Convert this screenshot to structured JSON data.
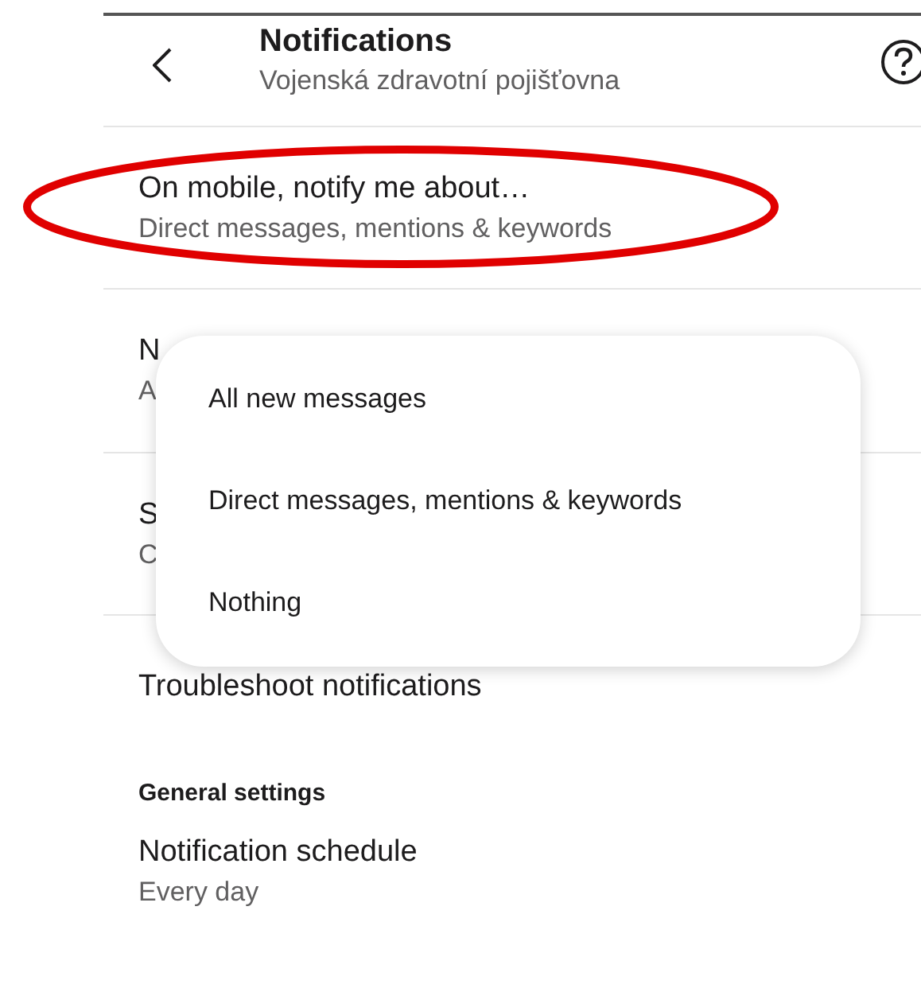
{
  "header": {
    "title": "Notifications",
    "subtitle": "Vojenská zdravotní pojišťovna"
  },
  "rows": [
    {
      "title": "On mobile, notify me about…",
      "subtitle": "Direct messages, mentions & keywords",
      "highlighted": true
    },
    {
      "title": "N",
      "subtitle": "A",
      "highlighted": false
    },
    {
      "title": "S",
      "subtitle": "C",
      "highlighted": false
    },
    {
      "title": "Troubleshoot notifications",
      "highlighted": false
    }
  ],
  "sections": [
    {
      "heading": "General settings",
      "rows": [
        {
          "title": "Notification schedule",
          "subtitle": "Every day"
        }
      ]
    }
  ],
  "menu": {
    "options": [
      {
        "label": "All new messages"
      },
      {
        "label": "Direct messages, mentions & keywords"
      },
      {
        "label": "Nothing"
      }
    ]
  }
}
